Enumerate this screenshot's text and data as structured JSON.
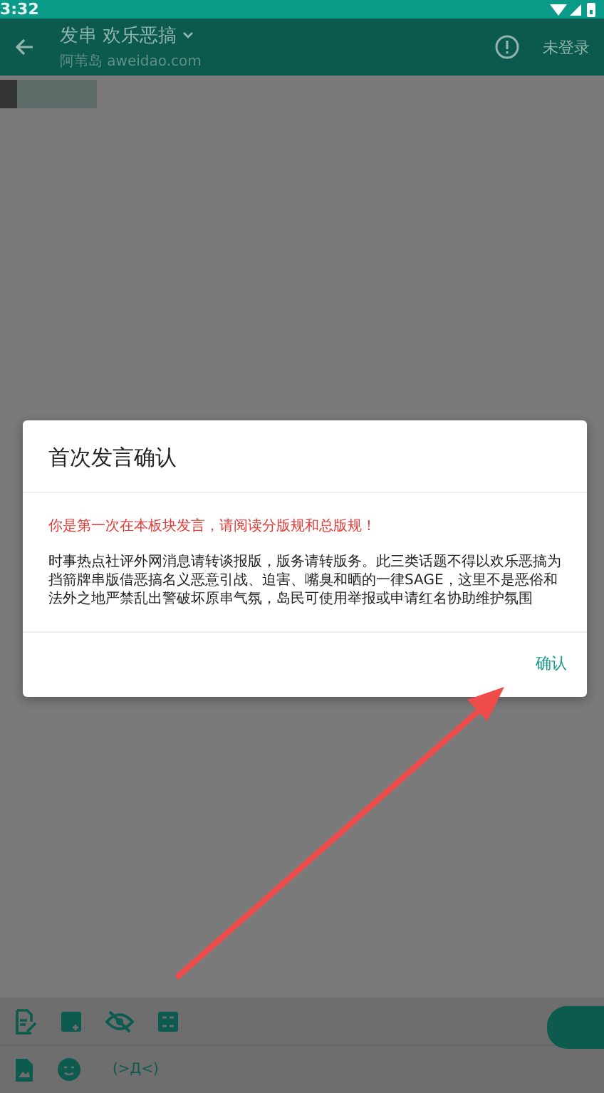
{
  "status_bar": {
    "time": "3:32"
  },
  "toolbar": {
    "title": "发串 欢乐恶搞",
    "subtitle": "阿苇岛 aweidao.com",
    "action": "未登录"
  },
  "dialog": {
    "title": "首次发言确认",
    "warning": "你是第一次在本板块发言，请阅读分版规和总版规！",
    "body": "时事热点社评外网消息请转谈报版，版务请转版务。此三类话题不得以欢乐恶搞为挡箭牌串版借恶搞名义恶意引战、迫害、嘴臭和晒的一律SAGE，这里不是恶俗和法外之地严禁乱出警破坏原串气氛，岛民可使用举报或申请红名协助维护氛围",
    "button": "确认"
  },
  "compose_toolbar": {
    "kaomoji": "(>Д<)"
  }
}
